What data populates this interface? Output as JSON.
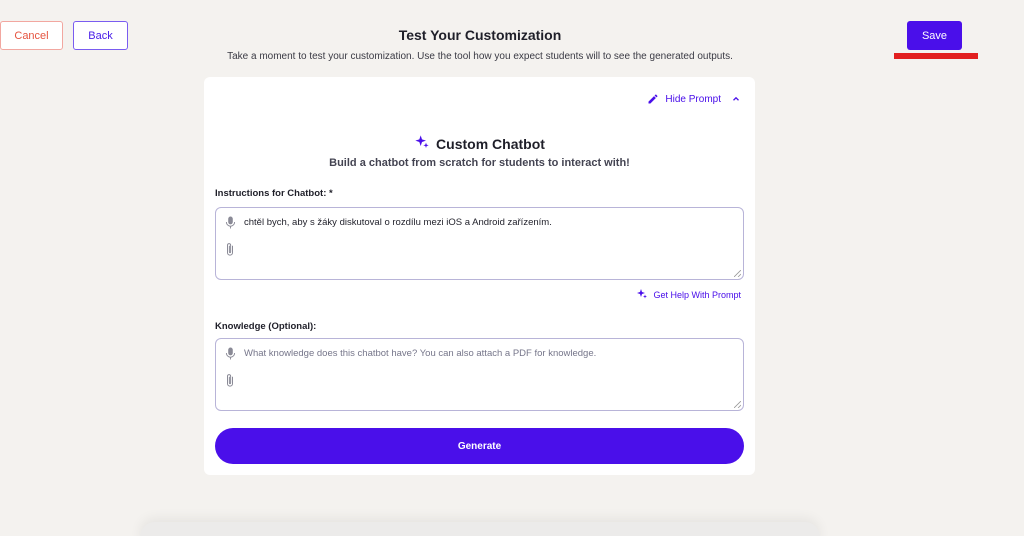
{
  "header": {
    "cancel_label": "Cancel",
    "back_label": "Back",
    "save_label": "Save",
    "title": "Test Your Customization",
    "subtitle": "Take a moment to test your customization. Use the tool how you expect students will to see the generated outputs."
  },
  "card": {
    "hide_prompt_label": "Hide Prompt",
    "tool_title": "Custom Chatbot",
    "tool_subtitle": "Build a chatbot from scratch for students to interact with!",
    "instructions": {
      "label": "Instructions for Chatbot:",
      "required_mark": "*",
      "value": "chtěl bych, aby s žáky diskutoval o rozdílu mezi iOS a Android zařízením."
    },
    "get_help_label": "Get Help With Prompt",
    "knowledge": {
      "label": "Knowledge (Optional):",
      "placeholder": "What knowledge does this chatbot have? You can also attach a PDF for knowledge."
    },
    "generate_label": "Generate"
  },
  "colors": {
    "accent": "#4a0fea",
    "cancel": "#e5533f",
    "annotation_underline": "#e21f1f",
    "background": "#f4f2ef"
  },
  "icons": [
    "pencil-icon",
    "chevron-up-icon",
    "sparkle-icon",
    "microphone-icon",
    "paperclip-icon"
  ]
}
